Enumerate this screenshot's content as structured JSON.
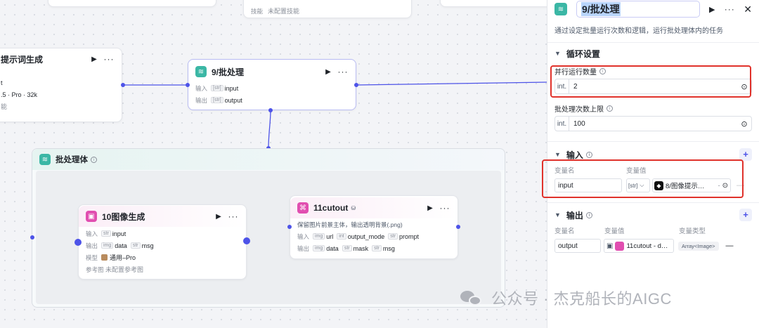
{
  "canvas": {
    "top_node": {
      "label": "技能",
      "value": "未配置技能"
    },
    "left_node": {
      "title": "提示词生成",
      "row1": "t",
      "row2": ".5 · Pro · 32k",
      "row3": "能"
    },
    "batch_node": {
      "title": "9/批处理",
      "input_label": "输入",
      "input_type": "[str]",
      "input_name": "input",
      "output_label": "输出",
      "output_type": "[str]",
      "output_name": "output"
    },
    "group": {
      "title": "批处理体"
    },
    "img_node": {
      "title": "10图像生成",
      "in_label": "输入",
      "in_type": "str",
      "in_name": "input",
      "out_label": "输出",
      "out_type1": "img",
      "out_name1": "data",
      "out_type2": "str",
      "out_name2": "msg",
      "model_label": "模型",
      "model_value": "通用–Pro",
      "ref_label": "参考图",
      "ref_value": "未配置参考图"
    },
    "cut_node": {
      "title": "11cutout",
      "desc": "保留图片前景主体，输出透明背景(.png)",
      "in_label": "输入",
      "in_t1": "img",
      "in_n1": "url",
      "in_t2": "int",
      "in_n2": "output_mode",
      "in_t3": "str",
      "in_n3": "prompt",
      "out_label": "输出",
      "out_t1": "img",
      "out_n1": "data",
      "out_t2": "str",
      "out_n2": "mask",
      "out_t3": "str",
      "out_n3": "msg"
    }
  },
  "panel": {
    "title": "9/批处理",
    "description": "通过设定批量运行次数和逻辑，运行批处理体内的任务",
    "loop_section": "循环设置",
    "parallel_label": "并行运行数量",
    "parallel_prefix": "int.",
    "parallel_value": "2",
    "limit_label": "批处理次数上限",
    "limit_prefix": "int.",
    "limit_value": "100",
    "input_section": "输入",
    "input_col_name": "变量名",
    "input_col_value": "变量值",
    "input_var_name": "input",
    "input_var_type": "[str]",
    "input_var_ref": "8/图像提示…",
    "input_var_ref_suffix": "-",
    "output_section": "输出",
    "output_col_name": "变量名",
    "output_col_value": "变量值",
    "output_col_type": "变量类型",
    "output_var_name": "output",
    "output_var_ref": "11cutout - d…",
    "output_var_type": "Array<Image>",
    "remove": "—"
  },
  "watermark": "公众号 · 杰克船长的AIGC",
  "colors": {
    "accent": "#4d53e8",
    "highlight": "#e0322b",
    "teal": "#3bb7a5",
    "pink": "#e14eb0"
  }
}
